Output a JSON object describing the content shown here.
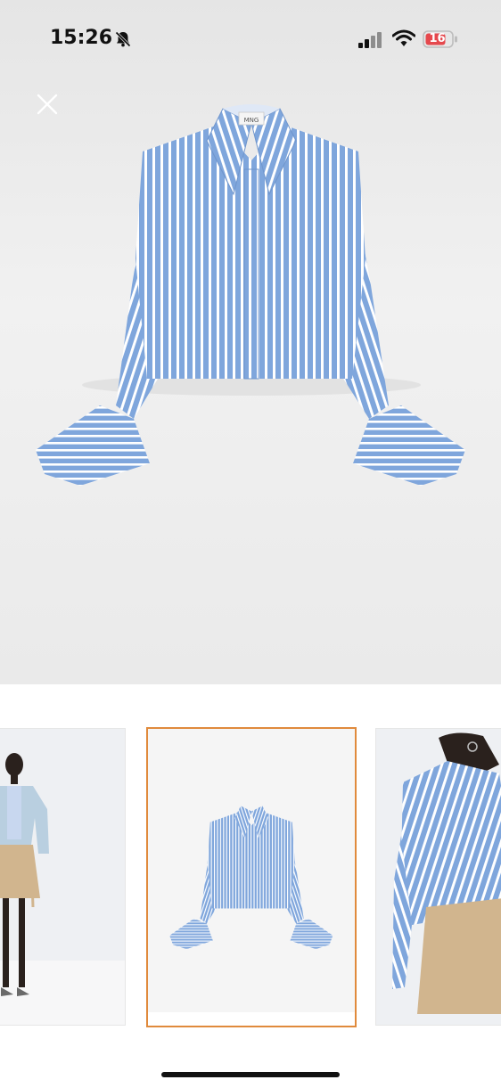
{
  "status_bar": {
    "time": "15:26",
    "battery_level": "16",
    "icons": [
      "bell-slash-icon",
      "cellular-signal-icon",
      "wifi-icon",
      "battery-icon"
    ],
    "battery_color": "#e5484d"
  },
  "product_image": {
    "icon": "close-icon",
    "label_text": "MNG"
  },
  "thumbnails": {
    "selected_index": 1,
    "selected_border_color": "#e08a3c"
  },
  "colors": {
    "shirt_blue": "#8fb0e0",
    "shirt_stripe": "#ffffff",
    "skirt_beige": "#d1b58e"
  }
}
